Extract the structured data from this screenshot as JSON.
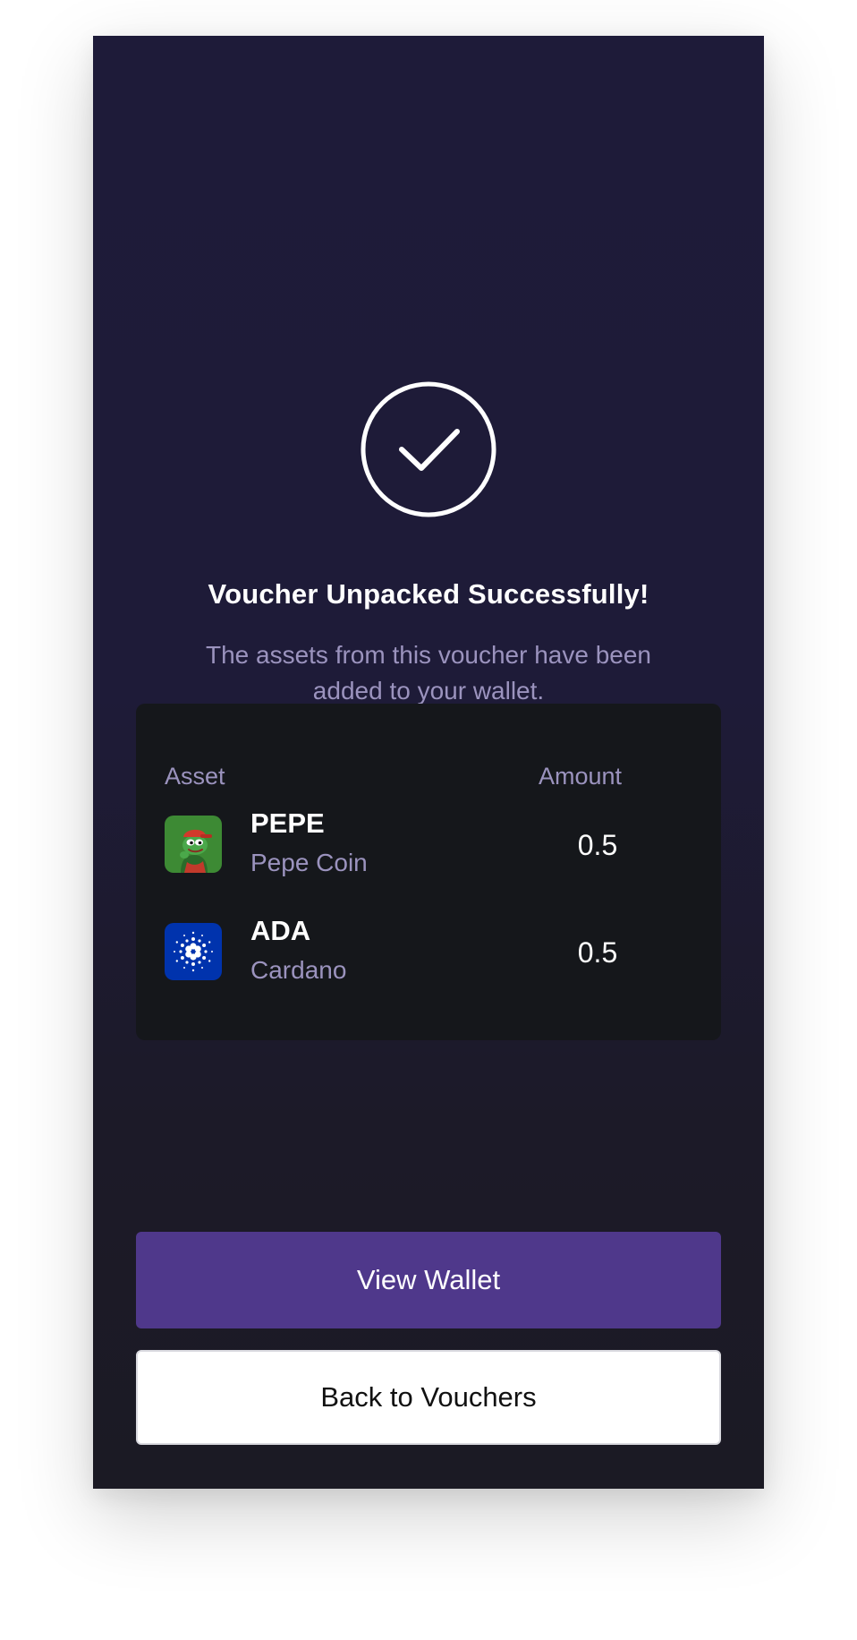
{
  "status": {
    "title": "Voucher Unpacked Successfully!",
    "subtitle": "The assets from this voucher have been added to your wallet."
  },
  "assets_table": {
    "headers": {
      "asset": "Asset",
      "amount": "Amount"
    },
    "rows": [
      {
        "symbol": "PEPE",
        "name": "Pepe Coin",
        "amount": "0.5",
        "icon": "pepe-frog-icon"
      },
      {
        "symbol": "ADA",
        "name": "Cardano",
        "amount": "0.5",
        "icon": "cardano-logo-icon"
      }
    ]
  },
  "actions": {
    "view_wallet": "View Wallet",
    "back_to_vouchers": "Back to Vouchers"
  },
  "colors": {
    "background": "#1e1b38",
    "card": "#15171b",
    "muted_text": "#9b93be",
    "primary_button": "#4f388b",
    "secondary_button": "#ffffff",
    "pepe_icon_bg": "#3d8a34",
    "ada_icon_bg": "#0033ad"
  }
}
